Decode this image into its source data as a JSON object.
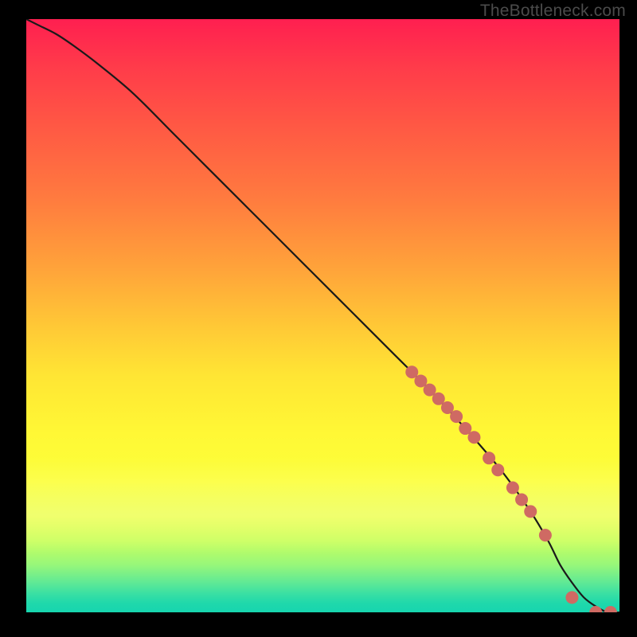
{
  "watermark": "TheBottleneck.com",
  "colors": {
    "curve_stroke": "#1a1a1a",
    "dot_fill": "#cf6a63",
    "dot_stroke": "#cf6a63"
  },
  "chart_data": {
    "type": "line",
    "title": "",
    "xlabel": "",
    "ylabel": "",
    "xlim": [
      0,
      100
    ],
    "ylim": [
      0,
      100
    ],
    "grid": false,
    "legend": false,
    "series": [
      {
        "name": "curve",
        "x": [
          0,
          2,
          5,
          8,
          12,
          18,
          25,
          32,
          40,
          48,
          55,
          62,
          68,
          74,
          80,
          85,
          88,
          90,
          92,
          94,
          96,
          98,
          100
        ],
        "y": [
          100,
          99,
          97.5,
          95.5,
          92.5,
          87.5,
          80.5,
          73.5,
          65.5,
          57.5,
          50.5,
          43.5,
          37.5,
          31,
          24,
          17,
          12,
          8,
          5,
          2.5,
          1,
          0,
          0
        ]
      }
    ],
    "dots": {
      "name": "highlighted-points",
      "x": [
        65,
        66.5,
        68,
        69.5,
        71,
        72.5,
        74,
        75.5,
        78,
        79.5,
        82,
        83.5,
        85,
        87.5,
        92,
        96,
        98.5
      ],
      "y": [
        40.5,
        39,
        37.5,
        36,
        34.5,
        33,
        31,
        29.5,
        26,
        24,
        21,
        19,
        17,
        13,
        2.5,
        0,
        0
      ]
    }
  }
}
